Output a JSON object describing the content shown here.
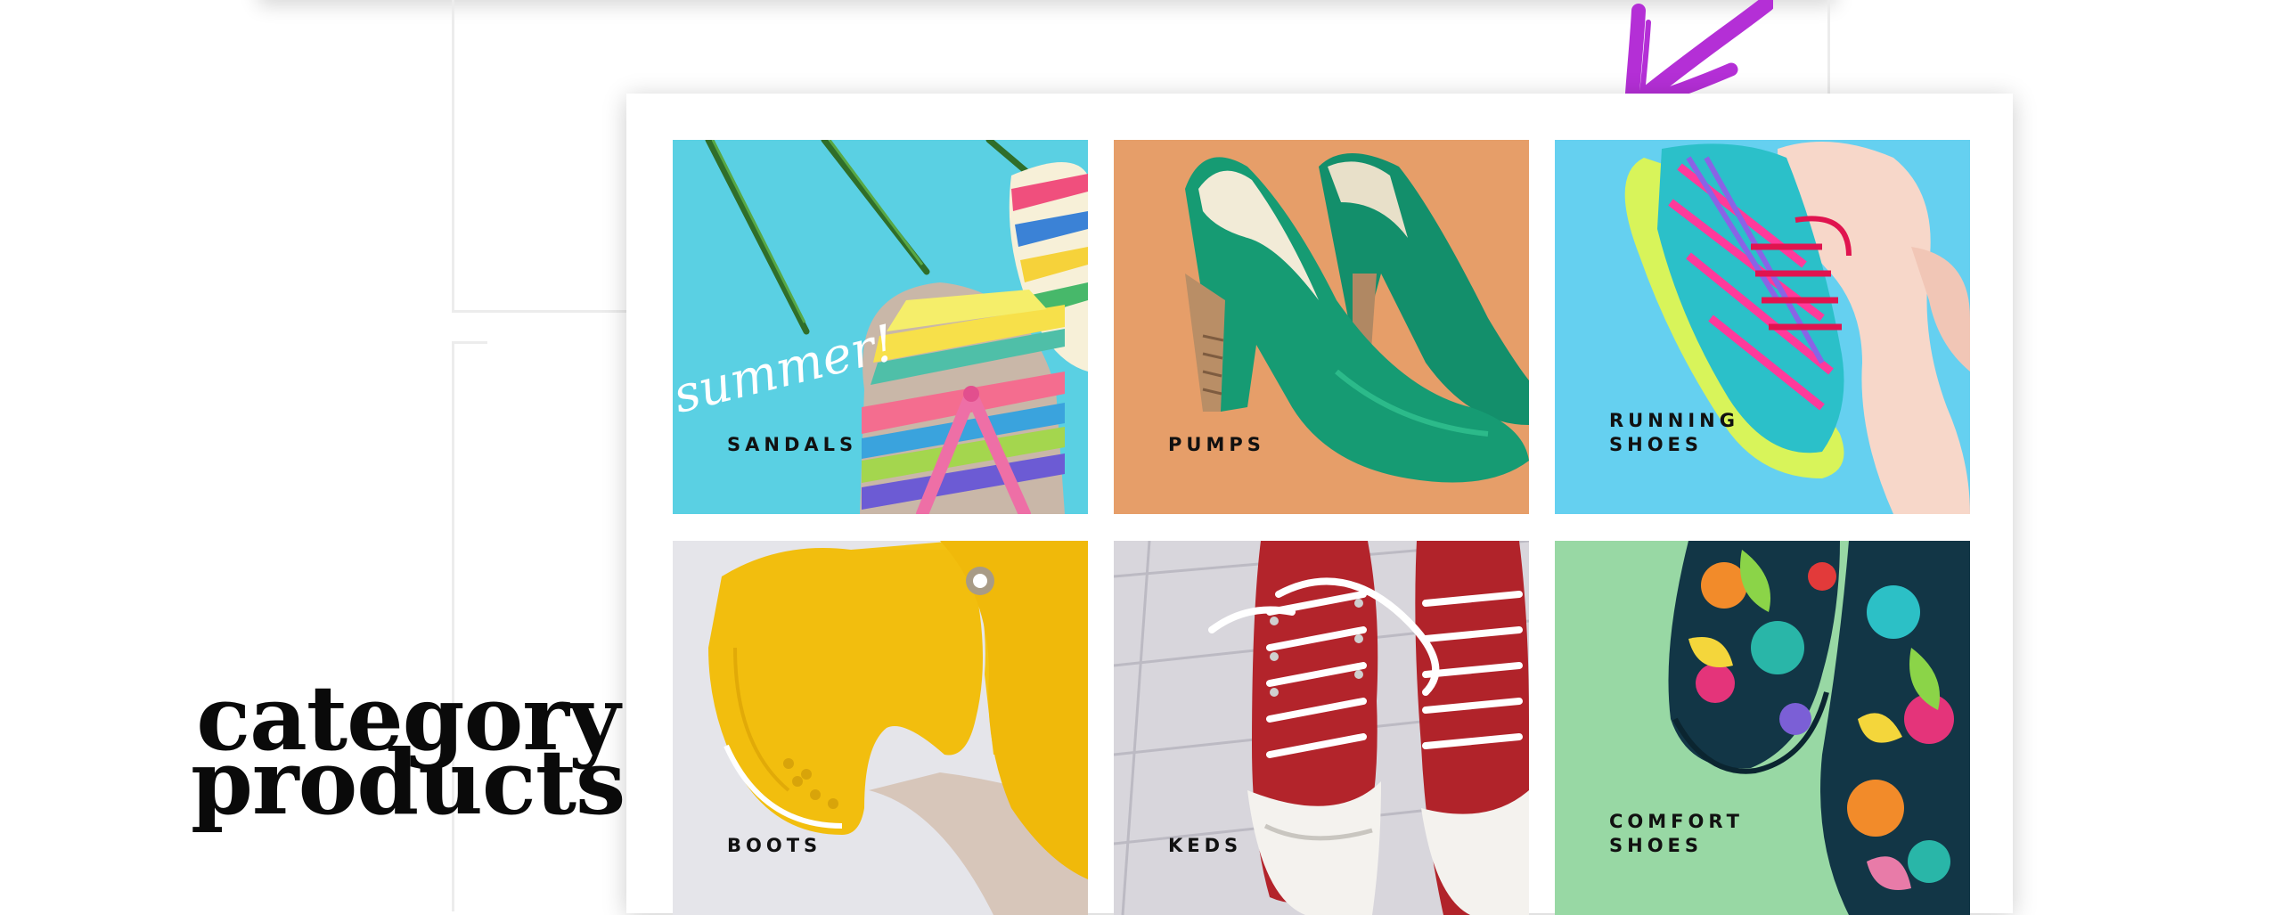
{
  "section": {
    "heading_line1": "category",
    "heading_line2": "products"
  },
  "tiles": [
    {
      "label": "SANDALS",
      "overlay_text": "summer!"
    },
    {
      "label": "PUMPS"
    },
    {
      "label": "RUNNING\nSHOES"
    },
    {
      "label": "BOOTS"
    },
    {
      "label": "KEDS"
    },
    {
      "label": "COMFORT\nSHOES"
    }
  ],
  "colors": {
    "sandals_bg": "#5ad0e3",
    "pumps_bg": "#e9a06c",
    "running_bg": "#6fd4f1",
    "boots_bg": "#ebebee",
    "keds_bg": "#d8d6dc",
    "comfort_bg": "#98d8a4",
    "arrow": "#b42fd6"
  },
  "icons": {
    "arrow": "arrow-pointer-icon"
  }
}
